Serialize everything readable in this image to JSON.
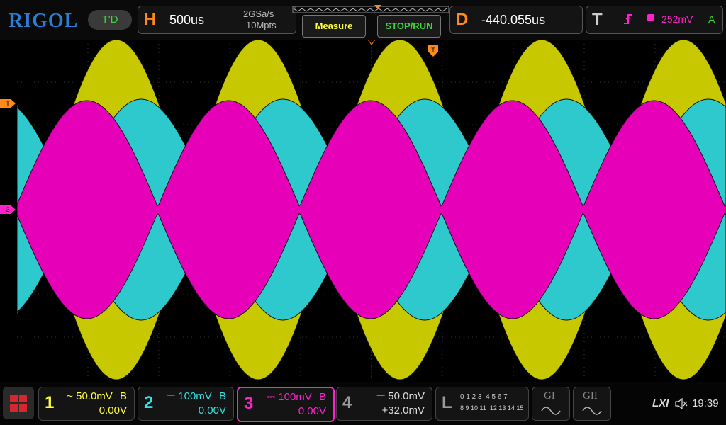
{
  "brand": "RIGOL",
  "mode": "T'D",
  "horizontal": {
    "letter": "H",
    "timebase": "500us",
    "sample_rate": "2GSa/s",
    "memory": "10Mpts"
  },
  "buttons": {
    "measure": "Measure",
    "stop_run": "STOP/RUN"
  },
  "delay": {
    "letter": "D",
    "value": "-440.055us"
  },
  "trigger": {
    "letter": "T",
    "level": "252mV",
    "mode": "A"
  },
  "screen_markers": {
    "trigger_level": "T",
    "ch3_offset": "3",
    "trigger_pos": "T"
  },
  "channels": [
    {
      "num": "1",
      "scale": "50.0mV",
      "bw": "B",
      "offset": "0.00V",
      "color": "#ffff3a",
      "coupling": "~"
    },
    {
      "num": "2",
      "scale": "100mV",
      "bw": "B",
      "offset": "0.00V",
      "color": "#34e1e6",
      "coupling": "⎓"
    },
    {
      "num": "3",
      "scale": "100mV",
      "bw": "B",
      "offset": "0.00V",
      "color": "#ff22cc",
      "coupling": "⎓"
    },
    {
      "num": "4",
      "scale": "50.0mV",
      "bw": "",
      "offset": "+32.0mV",
      "color": "#9a9a9a",
      "coupling": "⎓"
    }
  ],
  "logic": {
    "letter": "L",
    "row1": "0 1 2 3  4 5 6 7",
    "row2": "8 9 10 11  12 13 14 15"
  },
  "gen": [
    {
      "label": "GI"
    },
    {
      "label": "GII"
    }
  ],
  "status": {
    "lxi": "LXI",
    "time": "19:39"
  },
  "colors": {
    "ch1": "#c8c800",
    "ch2": "#2ec9cc",
    "ch3": "#e600b8",
    "trigger": "#ff8a1a",
    "brand": "#2a7fd4"
  }
}
